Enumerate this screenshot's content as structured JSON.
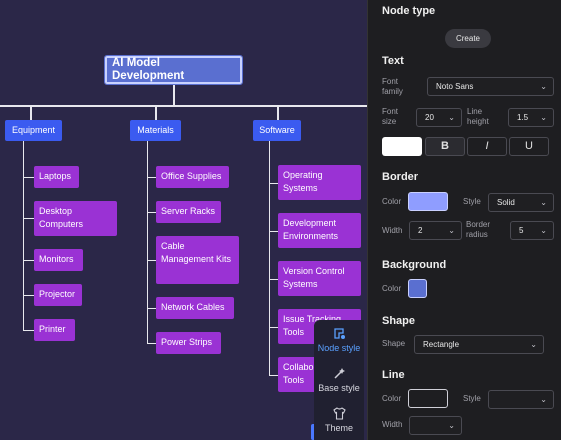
{
  "mindmap": {
    "root": "AI Model Development",
    "categories": [
      {
        "label": "Equipment",
        "children": [
          "Laptops",
          "Desktop Computers",
          "Monitors",
          "Projector",
          "Printer"
        ]
      },
      {
        "label": "Materials",
        "children": [
          "Office Supplies",
          "Server Racks",
          "Cable Management Kits",
          "Network Cables",
          "Power Strips"
        ]
      },
      {
        "label": "Software",
        "children": [
          "Operating Systems",
          "Development Environments",
          "Version Control Systems",
          "Issue Tracking Tools",
          "Collaboration Tools"
        ]
      }
    ]
  },
  "float_toolbar": {
    "items": [
      {
        "label": "Node style",
        "icon": "node-style-icon",
        "active": true
      },
      {
        "label": "Base style",
        "icon": "magic-wand-icon",
        "active": false
      },
      {
        "label": "Theme",
        "icon": "shirt-icon",
        "active": false
      }
    ]
  },
  "panel": {
    "node_type": {
      "title": "Node type",
      "create_label": "Create"
    },
    "text": {
      "title": "Text",
      "font_family_label": "Font family",
      "font_family_value": "Noto Sans",
      "font_size_label": "Font size",
      "font_size_value": "20",
      "line_height_label": "Line height",
      "line_height_value": "1.5",
      "bold_label": "B",
      "italic_label": "I",
      "underline_label": "U",
      "color": "#ffffff"
    },
    "border": {
      "title": "Border",
      "color_label": "Color",
      "color": "#8f9dff",
      "style_label": "Style",
      "style_value": "Solid",
      "width_label": "Width",
      "width_value": "2",
      "radius_label": "Border radius",
      "radius_value": "5"
    },
    "background": {
      "title": "Background",
      "color_label": "Color",
      "color": "#5a6fd0"
    },
    "shape": {
      "title": "Shape",
      "shape_label": "Shape",
      "shape_value": "Rectangle"
    },
    "line": {
      "title": "Line",
      "color_label": "Color",
      "color": "#1e1e21",
      "style_label": "Style",
      "style_value": "",
      "width_label": "Width",
      "width_value": ""
    }
  },
  "colors": {
    "canvas_bg": "#2b2748",
    "root_bg": "#5a6fd0",
    "category_bg": "#3b5bf0",
    "leaf_bg": "#9a32d4",
    "panel_bg": "#1e1e21",
    "accent": "#5aa0ff"
  }
}
